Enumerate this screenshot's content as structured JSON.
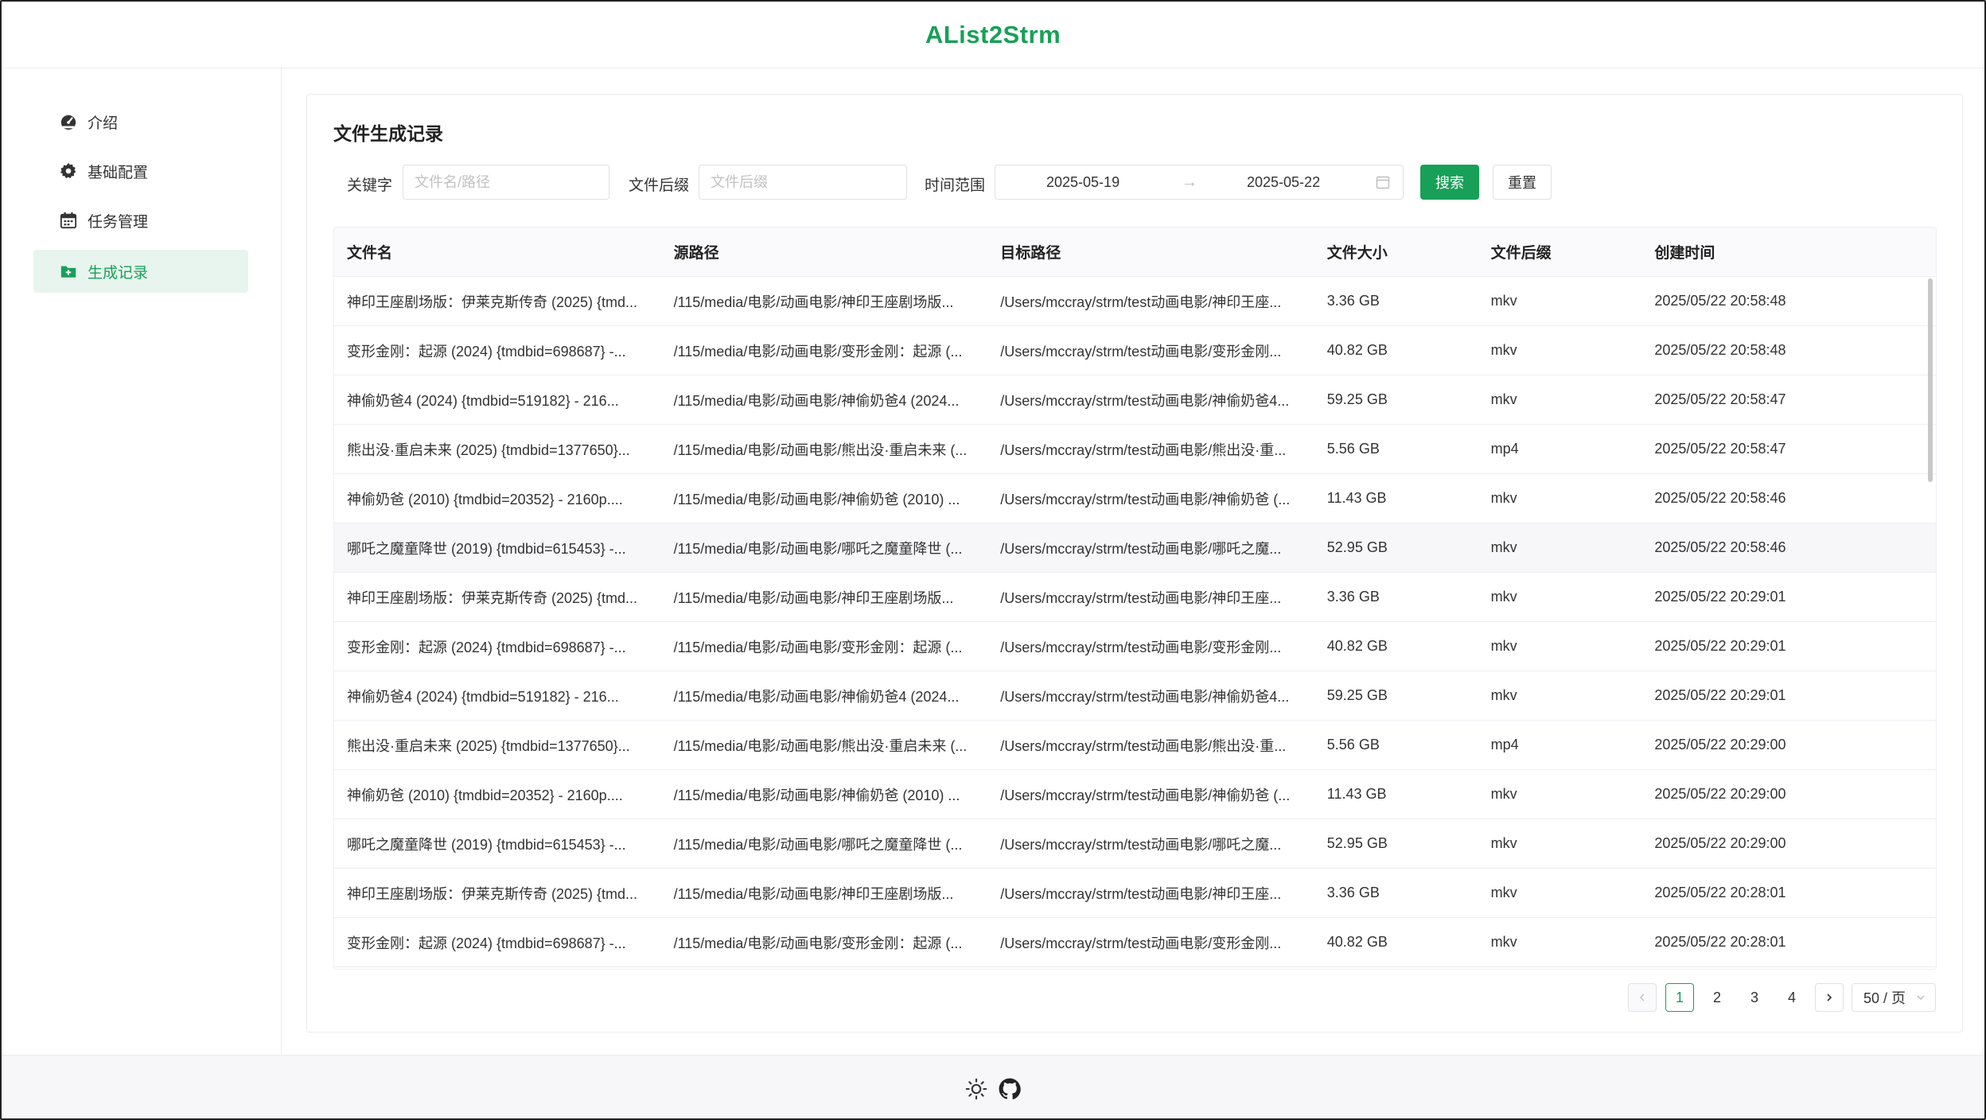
{
  "app": {
    "title": "AList2Strm"
  },
  "sidebar": {
    "items": [
      {
        "label": "介绍",
        "icon": "dashboard-icon"
      },
      {
        "label": "基础配置",
        "icon": "gear-icon"
      },
      {
        "label": "任务管理",
        "icon": "calendar-icon"
      },
      {
        "label": "生成记录",
        "icon": "folder-add-icon",
        "active": true
      }
    ]
  },
  "page": {
    "title": "文件生成记录",
    "filters": {
      "keyword_label": "关键字",
      "keyword_placeholder": "文件名/路径",
      "suffix_label": "文件后缀",
      "suffix_placeholder": "文件后缀",
      "range_label": "时间范围",
      "start_date": "2025-05-19",
      "end_date": "2025-05-22",
      "search_label": "搜索",
      "reset_label": "重置"
    }
  },
  "table": {
    "columns": [
      "文件名",
      "源路径",
      "目标路径",
      "文件大小",
      "文件后缀",
      "创建时间"
    ],
    "rows": [
      [
        "神印王座剧场版：伊莱克斯传奇 (2025) {tmd...",
        "/115/media/电影/动画电影/神印王座剧场版...",
        "/Users/mccray/strm/test动画电影/神印王座...",
        "3.36 GB",
        "mkv",
        "2025/05/22 20:58:48"
      ],
      [
        "变形金刚：起源 (2024) {tmdbid=698687} -...",
        "/115/media/电影/动画电影/变形金刚：起源 (...",
        "/Users/mccray/strm/test动画电影/变形金刚...",
        "40.82 GB",
        "mkv",
        "2025/05/22 20:58:48"
      ],
      [
        "神偷奶爸4 (2024) {tmdbid=519182} - 216...",
        "/115/media/电影/动画电影/神偷奶爸4 (2024...",
        "/Users/mccray/strm/test动画电影/神偷奶爸4...",
        "59.25 GB",
        "mkv",
        "2025/05/22 20:58:47"
      ],
      [
        "熊出没·重启未来 (2025) {tmdbid=1377650}...",
        "/115/media/电影/动画电影/熊出没·重启未来 (...",
        "/Users/mccray/strm/test动画电影/熊出没·重...",
        "5.56 GB",
        "mp4",
        "2025/05/22 20:58:47"
      ],
      [
        "神偷奶爸 (2010) {tmdbid=20352} - 2160p....",
        "/115/media/电影/动画电影/神偷奶爸 (2010) ...",
        "/Users/mccray/strm/test动画电影/神偷奶爸 (...",
        "11.43 GB",
        "mkv",
        "2025/05/22 20:58:46"
      ],
      [
        "哪吒之魔童降世 (2019) {tmdbid=615453} -...",
        "/115/media/电影/动画电影/哪吒之魔童降世 (...",
        "/Users/mccray/strm/test动画电影/哪吒之魔...",
        "52.95 GB",
        "mkv",
        "2025/05/22 20:58:46"
      ],
      [
        "神印王座剧场版：伊莱克斯传奇 (2025) {tmd...",
        "/115/media/电影/动画电影/神印王座剧场版...",
        "/Users/mccray/strm/test动画电影/神印王座...",
        "3.36 GB",
        "mkv",
        "2025/05/22 20:29:01"
      ],
      [
        "变形金刚：起源 (2024) {tmdbid=698687} -...",
        "/115/media/电影/动画电影/变形金刚：起源 (...",
        "/Users/mccray/strm/test动画电影/变形金刚...",
        "40.82 GB",
        "mkv",
        "2025/05/22 20:29:01"
      ],
      [
        "神偷奶爸4 (2024) {tmdbid=519182} - 216...",
        "/115/media/电影/动画电影/神偷奶爸4 (2024...",
        "/Users/mccray/strm/test动画电影/神偷奶爸4...",
        "59.25 GB",
        "mkv",
        "2025/05/22 20:29:01"
      ],
      [
        "熊出没·重启未来 (2025) {tmdbid=1377650}...",
        "/115/media/电影/动画电影/熊出没·重启未来 (...",
        "/Users/mccray/strm/test动画电影/熊出没·重...",
        "5.56 GB",
        "mp4",
        "2025/05/22 20:29:00"
      ],
      [
        "神偷奶爸 (2010) {tmdbid=20352} - 2160p....",
        "/115/media/电影/动画电影/神偷奶爸 (2010) ...",
        "/Users/mccray/strm/test动画电影/神偷奶爸 (...",
        "11.43 GB",
        "mkv",
        "2025/05/22 20:29:00"
      ],
      [
        "哪吒之魔童降世 (2019) {tmdbid=615453} -...",
        "/115/media/电影/动画电影/哪吒之魔童降世 (...",
        "/Users/mccray/strm/test动画电影/哪吒之魔...",
        "52.95 GB",
        "mkv",
        "2025/05/22 20:29:00"
      ],
      [
        "神印王座剧场版：伊莱克斯传奇 (2025) {tmd...",
        "/115/media/电影/动画电影/神印王座剧场版...",
        "/Users/mccray/strm/test动画电影/神印王座...",
        "3.36 GB",
        "mkv",
        "2025/05/22 20:28:01"
      ],
      [
        "变形金刚：起源 (2024) {tmdbid=698687} -...",
        "/115/media/电影/动画电影/变形金刚：起源 (...",
        "/Users/mccray/strm/test动画电影/变形金刚...",
        "40.82 GB",
        "mkv",
        "2025/05/22 20:28:01"
      ]
    ]
  },
  "pagination": {
    "pages": [
      "1",
      "2",
      "3",
      "4"
    ],
    "current": "1",
    "page_size": "50 / 页"
  },
  "footer": {
    "icons": [
      "sun-icon",
      "github-icon"
    ]
  },
  "colors": {
    "accent": "#18a058",
    "active_bg": "#e7f5ee"
  }
}
